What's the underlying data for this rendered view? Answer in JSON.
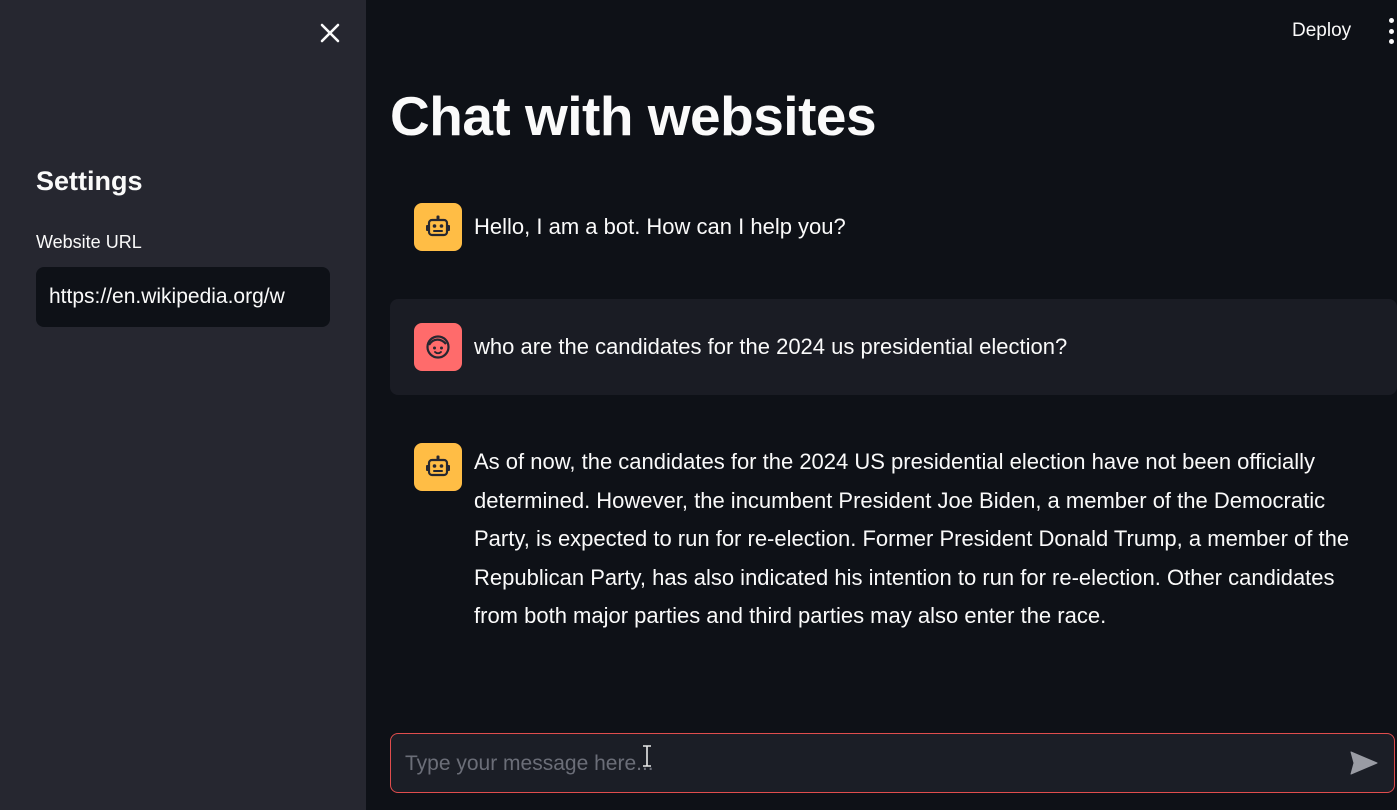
{
  "sidebar": {
    "close_icon": "close-icon",
    "title": "Settings",
    "url_label": "Website URL",
    "url_value": "https://en.wikipedia.org/w"
  },
  "header": {
    "deploy_label": "Deploy",
    "menu_icon": "vertical-dots-icon"
  },
  "main": {
    "title": "Chat with websites",
    "messages": [
      {
        "role": "bot",
        "avatar_icon": "robot-icon",
        "text": "Hello, I am a bot. How can I help you?"
      },
      {
        "role": "user",
        "avatar_icon": "face-icon",
        "text": "who are the candidates for the 2024 us presidential election?"
      },
      {
        "role": "bot",
        "avatar_icon": "robot-icon",
        "text": "As of now, the candidates for the 2024 US presidential election have not been officially determined. However, the incumbent President Joe Biden, a member of the Democratic Party, is expected to run for re-election. Former President Donald Trump, a member of the Republican Party, has also indicated his intention to run for re-election. Other candidates from both major parties and third parties may also enter the race."
      }
    ]
  },
  "chat_input": {
    "placeholder": "Type your message here...",
    "send_icon": "send-icon"
  },
  "colors": {
    "background": "#0e1117",
    "sidebar": "#262730",
    "bot_avatar": "#ffbd45",
    "user_avatar": "#ff6b6b",
    "input_border": "#e04d4d"
  }
}
